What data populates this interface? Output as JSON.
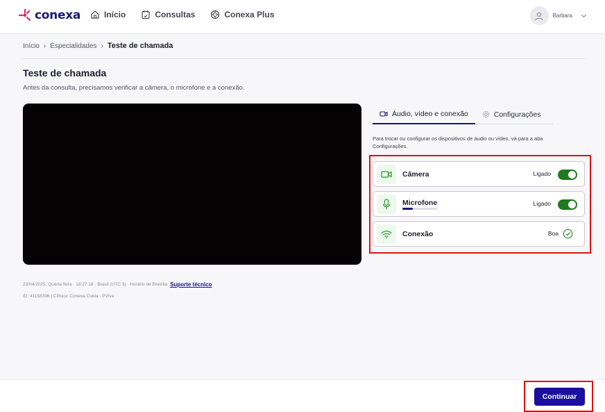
{
  "header": {
    "logo_text": "conexa",
    "nav": [
      {
        "label": "Início",
        "icon": "home-icon"
      },
      {
        "label": "Consultas",
        "icon": "calendar-icon"
      },
      {
        "label": "Conexa Plus",
        "icon": "plus-circle-icon"
      }
    ],
    "user_name": "Barbara"
  },
  "breadcrumb": [
    "Início",
    "Especialidades",
    "Teste de chamada"
  ],
  "page": {
    "title": "Teste de chamada",
    "subtitle": "Antes da consulta, precisamos verificar a câmera, o microfone e a conexão."
  },
  "meta": {
    "line1": "23/04/2025, Quarta feira · 18:27:18 · Brasil (UTC 3) · Horário de Brasília",
    "support_link": "Suporte técnico",
    "line2": "ID: 41158336 | Clínica: Conexa Cuida · PViva"
  },
  "tabs": [
    {
      "label": "Áudio, vídeo e conexão",
      "icon": "camera-icon",
      "active": true
    },
    {
      "label": "Configurações",
      "icon": "gear-icon",
      "active": false
    }
  ],
  "helper_text": "Para trocar ou configurar os dispositivos de áudio ou vídeo, vá para a aba Configurações.",
  "devices": {
    "camera": {
      "label": "Câmera",
      "status": "Ligado",
      "icon": "camera-icon",
      "on": true
    },
    "microphone": {
      "label": "Microfone",
      "status": "Ligado",
      "icon": "microphone-icon",
      "on": true,
      "level_percent": 30
    },
    "connection": {
      "label": "Conexão",
      "status": "Boa",
      "icon": "wifi-icon"
    }
  },
  "footer": {
    "continue_label": "Continuar"
  },
  "colors": {
    "brand": "#1a0fa0",
    "accent_pink": "#e0245e",
    "toggle_on": "#1f7a1f",
    "highlight": "#dd1111"
  }
}
